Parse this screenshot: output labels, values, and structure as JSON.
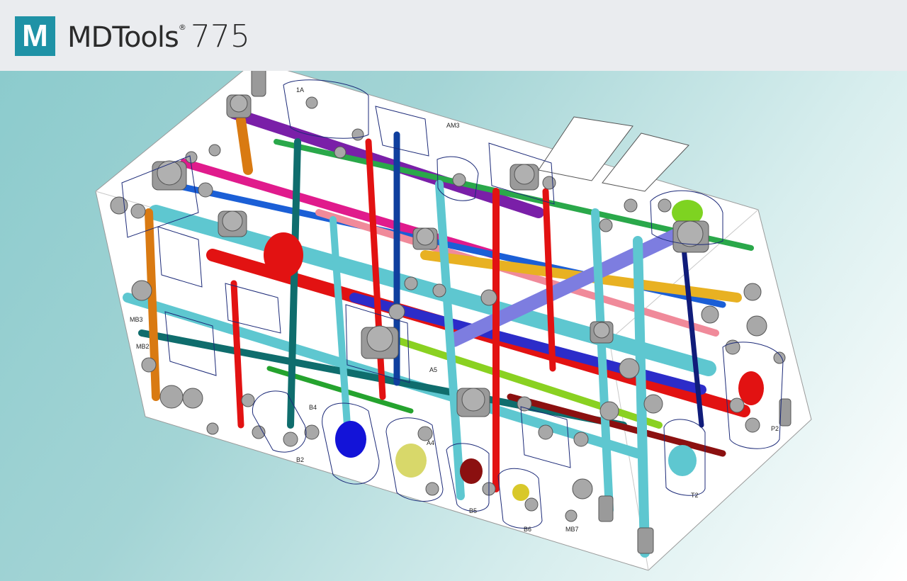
{
  "app": {
    "logo_letter": "M",
    "name": "MDTools",
    "trademark": "®",
    "version": "775"
  },
  "colors": {
    "logo_bg": "#1f92a6",
    "header_bg": "#eaecef",
    "background_start": "#8ccbcd",
    "background_end": "#ffffff",
    "block_outline": "#9a9a9a"
  },
  "model_labels": {
    "mb3": "MB3",
    "mb2": "MB2",
    "b4": "B4",
    "b2": "B2",
    "a4": "A4",
    "a5": "A5",
    "b5": "B5",
    "b6": "B6",
    "mb7": "MB7",
    "t2": "T2",
    "p2": "P2",
    "a1": "1A",
    "am3": "AM3"
  }
}
